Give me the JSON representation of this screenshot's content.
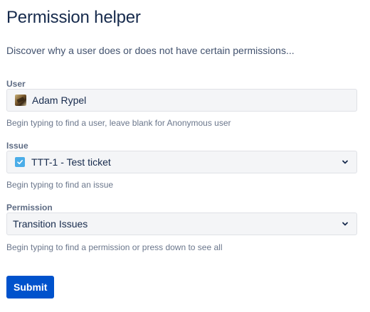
{
  "page": {
    "title": "Permission helper",
    "description": "Discover why a user does or does not have certain permissions..."
  },
  "form": {
    "user": {
      "label": "User",
      "value": "Adam Rypel",
      "helper": "Begin typing to find a user, leave blank for Anonymous user",
      "icon": "user-avatar"
    },
    "issue": {
      "label": "Issue",
      "value": "TTT-1 - Test ticket",
      "helper": "Begin typing to find an issue",
      "icon": "task-issue-type-icon"
    },
    "permission": {
      "label": "Permission",
      "value": "Transition Issues",
      "helper": "Begin typing to find a permission or press down to see all"
    },
    "submit_label": "Submit"
  },
  "colors": {
    "primary": "#0052cc",
    "field_bg": "#f4f5f7",
    "task_icon": "#4bade8",
    "heading": "#172b4d"
  }
}
